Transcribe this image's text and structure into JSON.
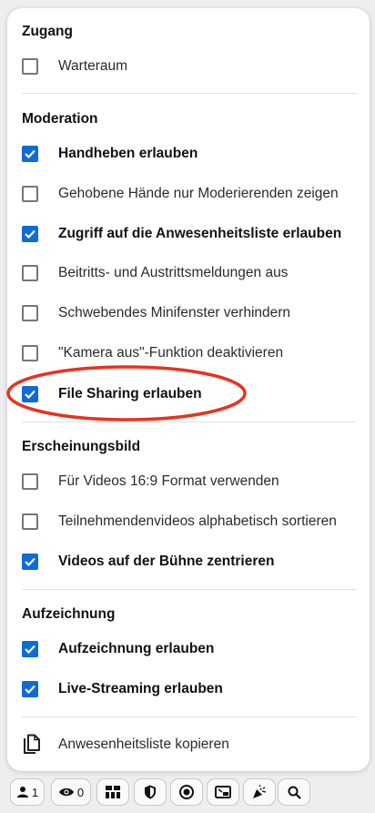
{
  "sections": {
    "zugang": {
      "title": "Zugang",
      "items": [
        {
          "label": "Warteraum",
          "checked": false
        }
      ]
    },
    "moderation": {
      "title": "Moderation",
      "items": [
        {
          "label": "Handheben erlauben",
          "checked": true
        },
        {
          "label": "Gehobene Hände nur Moderierenden zeigen",
          "checked": false
        },
        {
          "label": "Zugriff auf die Anwesenheitsliste erlauben",
          "checked": true
        },
        {
          "label": "Beitritts- und Austrittsmeldungen aus",
          "checked": false
        },
        {
          "label": "Schwebendes Minifenster verhindern",
          "checked": false
        },
        {
          "label": "\"Kamera aus\"-Funktion deaktivieren",
          "checked": false
        },
        {
          "label": "File Sharing erlauben",
          "checked": true
        }
      ]
    },
    "erscheinungsbild": {
      "title": "Erscheinungsbild",
      "items": [
        {
          "label": "Für Videos 16:9 Format verwenden",
          "checked": false
        },
        {
          "label": "Teilnehmendenvideos alphabetisch sortieren",
          "checked": false
        },
        {
          "label": "Videos auf der Bühne zentrieren",
          "checked": true
        }
      ]
    },
    "aufzeichnung": {
      "title": "Aufzeichnung",
      "items": [
        {
          "label": "Aufzeichnung erlauben",
          "checked": true
        },
        {
          "label": "Live-Streaming erlauben",
          "checked": true
        }
      ]
    }
  },
  "copy_action": {
    "label": "Anwesenheitsliste kopieren",
    "icon": "copy-icon"
  },
  "toolbar": {
    "participants": {
      "icon": "person-icon",
      "count": "1"
    },
    "viewers": {
      "icon": "eye-icon",
      "count": "0"
    },
    "layout": {
      "icon": "layout-grid-icon"
    },
    "security": {
      "icon": "shield-icon"
    },
    "record": {
      "icon": "record-icon"
    },
    "screen": {
      "icon": "screen-share-icon"
    },
    "reactions": {
      "icon": "party-popper-icon"
    },
    "search": {
      "icon": "search-icon"
    }
  },
  "colors": {
    "checkbox_checked": "#0f6bd6",
    "highlight_ellipse": "#e8321e"
  }
}
